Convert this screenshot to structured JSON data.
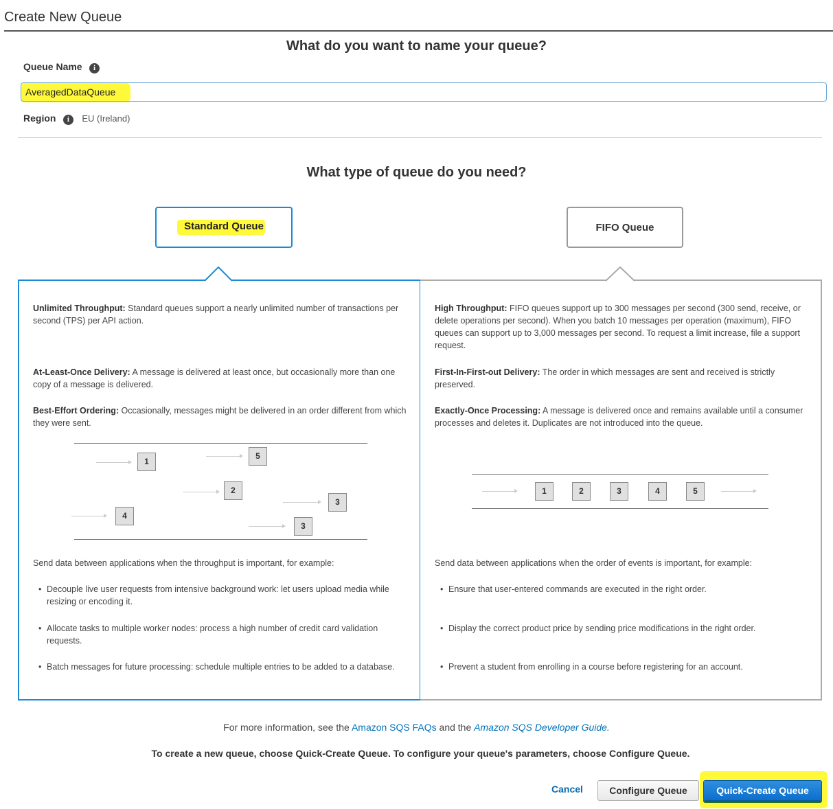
{
  "page": {
    "title": "Create New Queue"
  },
  "naming": {
    "heading": "What do you want to name your queue?",
    "queue_name_label": "Queue Name",
    "queue_name_value": "AveragedDataQueue",
    "region_label": "Region",
    "region_value": "EU (Ireland)"
  },
  "queue_type": {
    "heading": "What type of queue do you need?",
    "standard_label": "Standard Queue",
    "fifo_label": "FIFO Queue",
    "selected": "Standard Queue"
  },
  "standard": {
    "features": [
      {
        "title": "Unlimited Throughput:",
        "text": " Standard queues support a nearly unlimited number of transactions per second (TPS) per API action."
      },
      {
        "title": "At-Least-Once Delivery:",
        "text": " A message is delivered at least once, but occasionally more than one copy of a message is delivered."
      },
      {
        "title": "Best-Effort Ordering:",
        "text": " Occasionally, messages might be delivered in an order different from which they were sent."
      }
    ],
    "diagram_boxes": [
      "1",
      "5",
      "2",
      "3",
      "4",
      "3"
    ],
    "usage_intro": "Send data between applications when the throughput is important, for example:",
    "examples": [
      "Decouple live user requests from intensive background work: let users upload media while resizing or encoding it.",
      "Allocate tasks to multiple worker nodes: process a high number of credit card validation requests.",
      "Batch messages for future processing: schedule multiple entries to be added to a database."
    ]
  },
  "fifo": {
    "features": [
      {
        "title": "High Throughput:",
        "text": " FIFO queues support up to 300 messages per second (300 send, receive, or delete operations per second). When you batch 10 messages per operation (maximum), FIFO queues can support up to 3,000 messages per second. To request a limit increase, file a support request."
      },
      {
        "title": "First-In-First-out Delivery:",
        "text": " The order in which messages are sent and received is strictly preserved."
      },
      {
        "title": "Exactly-Once Processing:",
        "text": " A message is delivered once and remains available until a consumer processes and deletes it. Duplicates are not introduced into the queue."
      }
    ],
    "diagram_boxes": [
      "1",
      "2",
      "3",
      "4",
      "5"
    ],
    "usage_intro": "Send data between applications when the order of events is important, for example:",
    "examples": [
      "Ensure that user-entered commands are executed in the right order.",
      "Display the correct product price by sending price modifications in the right order.",
      "Prevent a student from enrolling in a course before registering for an account."
    ]
  },
  "footer": {
    "info_prefix": "For more information, see the",
    "faq_link": "Amazon SQS FAQs",
    "info_middle": "and the",
    "guide_link": "Amazon SQS Developer Guide",
    "info_suffix": ".",
    "instruction": "To create a new queue, choose Quick-Create Queue. To configure your queue's parameters, choose Configure Queue."
  },
  "actions": {
    "cancel": "Cancel",
    "configure": "Configure Queue",
    "quick_create": "Quick-Create Queue"
  },
  "colors": {
    "accent_blue": "#1a8ad4",
    "highlight_yellow": "#fff93a",
    "link_blue": "#0073bb"
  }
}
